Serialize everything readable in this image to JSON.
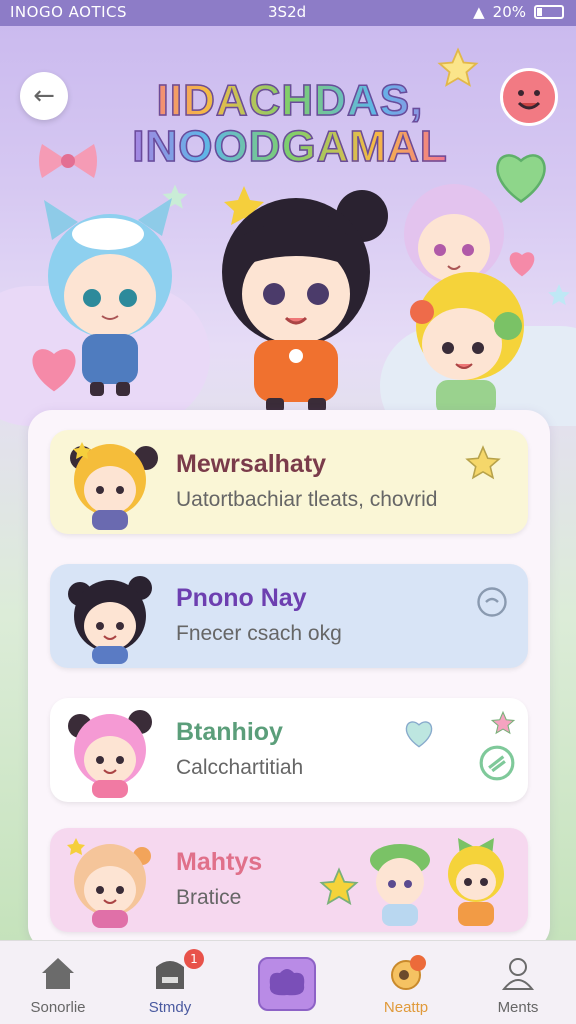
{
  "status_bar": {
    "left_text": "INOGO AOTICS",
    "time": "3S2d",
    "battery": "20%",
    "battery_level": 0.2
  },
  "header": {
    "logo_line1": "IIDACHDAS,",
    "logo_line2": "INOODGAMAL"
  },
  "cards": [
    {
      "title": "Mewrsalhaty",
      "subtitle": "Uatortbachiar tleats, chovrid",
      "bg": "#faf6d6",
      "title_color": "#7a3b4a"
    },
    {
      "title": "Pnono Nay",
      "subtitle": "Fnecer csach okg",
      "bg": "#d8e4f6",
      "title_color": "#6d3fb0"
    },
    {
      "title": "Btanhioy",
      "subtitle": "Calcchartitiah",
      "bg": "#ffffff",
      "title_color": "#5b9e7a"
    },
    {
      "title": "Mahtys",
      "subtitle": "Bratice",
      "bg": "#f6d8ef",
      "title_color": "#e0708a"
    }
  ],
  "bottom_nav": {
    "items": [
      {
        "label": "Sonorlie",
        "icon": "home-icon"
      },
      {
        "label": "Stmdy",
        "icon": "inbox-icon",
        "badge": "1"
      },
      {
        "label": "",
        "icon": "blob-center-icon"
      },
      {
        "label": "Neattp",
        "icon": "character-icon"
      },
      {
        "label": "Ments",
        "icon": "user-icon"
      }
    ]
  },
  "colors": {
    "status_bar": "#8d7cc7",
    "accent_purple": "#b98be6",
    "badge": "#e8524a"
  }
}
